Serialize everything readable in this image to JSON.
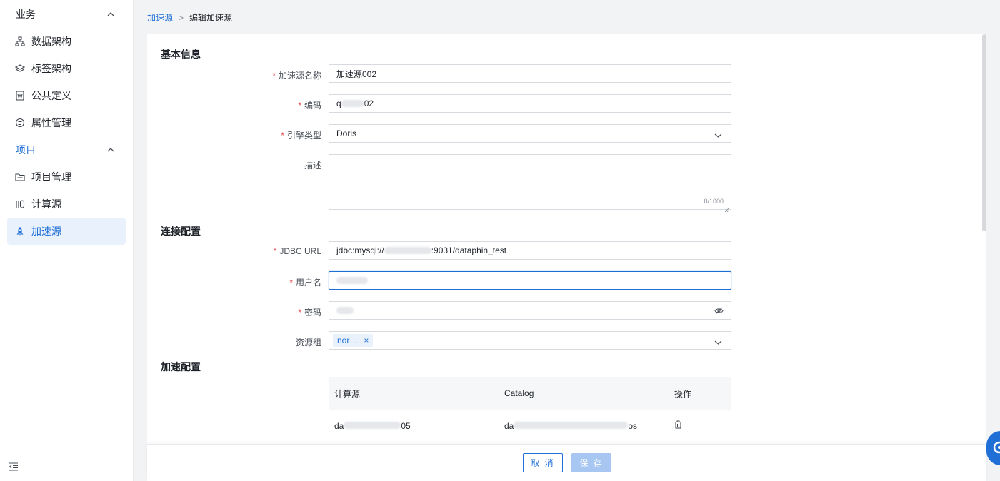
{
  "sidebar": {
    "groups": [
      {
        "label": "业务"
      },
      {
        "label": "项目"
      }
    ],
    "items": [
      {
        "label": "数据架构",
        "icon": "org-chart-icon"
      },
      {
        "label": "标签架构",
        "icon": "layers-icon"
      },
      {
        "label": "公共定义",
        "icon": "word-doc-icon"
      },
      {
        "label": "属性管理",
        "icon": "list-icon"
      },
      {
        "label": "项目管理",
        "icon": "folder-icon"
      },
      {
        "label": "计算源",
        "icon": "compute-icon"
      },
      {
        "label": "加速源",
        "icon": "rocket-icon"
      }
    ]
  },
  "breadcrumb": {
    "parent": "加速源",
    "separator": ">",
    "current": "编辑加速源"
  },
  "sections": {
    "basic": "基本信息",
    "connection": "连接配置",
    "acceleration": "加速配置"
  },
  "form": {
    "name": {
      "label": "加速源名称",
      "required": "*",
      "value": "加速源002"
    },
    "code": {
      "label": "编码",
      "required": "*",
      "prefix": "q",
      "suffix": "02"
    },
    "engine": {
      "label": "引擎类型",
      "required": "*",
      "value": "Doris"
    },
    "description": {
      "label": "描述",
      "counter": "0/1000"
    },
    "jdbc": {
      "label": "JDBC URL",
      "required": "*",
      "prefix": "jdbc:mysql://",
      "suffix": ":9031/dataphin_test"
    },
    "username": {
      "label": "用户名",
      "required": "*"
    },
    "password": {
      "label": "密码",
      "required": "*"
    },
    "resource_group": {
      "label": "资源组",
      "tag": "nor…",
      "tag_close": "×"
    }
  },
  "table": {
    "headers": [
      "计算源",
      "Catalog",
      "操作"
    ],
    "rows": [
      {
        "source_prefix": "da",
        "source_suffix": "05",
        "catalog_prefix": "da",
        "catalog_suffix": "os"
      }
    ]
  },
  "footer": {
    "cancel": "取 消",
    "save": "保 存"
  },
  "colors": {
    "accent": "#1f6fd6",
    "required": "#e5484d",
    "save_disabled": "#a7c7f2"
  }
}
